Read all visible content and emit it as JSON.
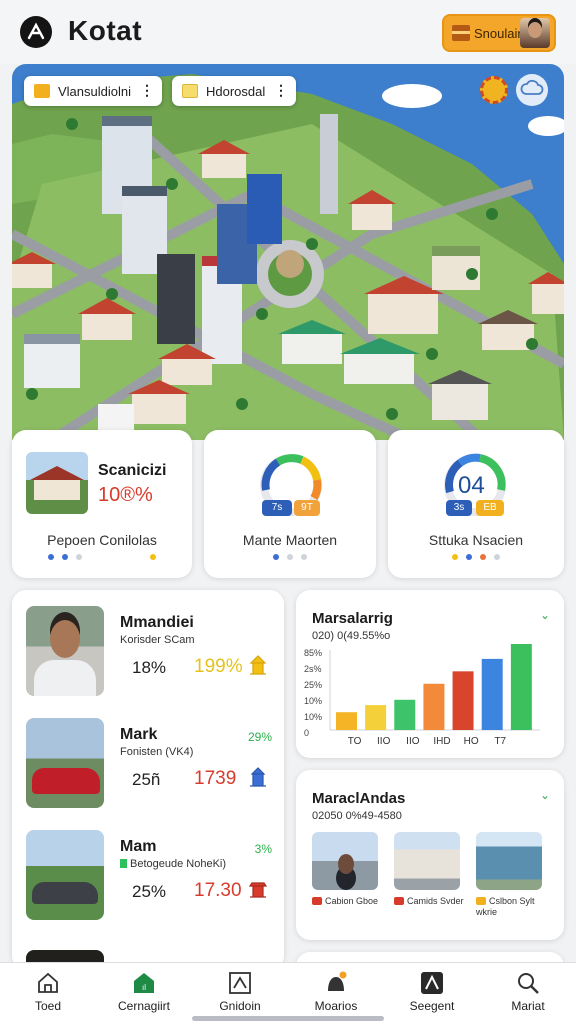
{
  "header": {
    "title": "Kotat",
    "logo_icon": "pen-logo-icon",
    "promo_label": "Snoulair",
    "promo_icon": "gift-box-icon"
  },
  "map": {
    "chips": [
      {
        "label": "Vlansuldiolni",
        "icon": "mail-icon"
      },
      {
        "label": "Hdorosdal",
        "icon": "note-icon"
      }
    ],
    "badge_icon": "award-badge-icon",
    "settings_icon": "cloud-settings-icon"
  },
  "stats": [
    {
      "title": "Scanicizi",
      "value": "10®%",
      "caption": "Pepoen Conilolas",
      "dots": [
        "#3b6fd4",
        "#3b6fd4",
        "#cfd3da",
        "#f2c010"
      ]
    },
    {
      "caption": "Mante Maorten",
      "gauge_value": 0.72,
      "pills": [
        "7s",
        "9T"
      ],
      "dots": [
        "#3b6fd4",
        "#cfd3da",
        "#cfd3da"
      ]
    },
    {
      "number": "04",
      "caption": "Sttuka Nsacien",
      "gauge_value": 0.8,
      "pills": [
        "3s",
        "EB"
      ],
      "dots": [
        "#f2c010",
        "#3b6fd4",
        "#e8743b",
        "#cfd3da"
      ]
    }
  ],
  "people": [
    {
      "name": "Mmandiei",
      "sub": "Korisder SCam",
      "left": "18%",
      "right": "199%",
      "right_color": "#e5c21c",
      "corner": "",
      "icon": "temple-icon"
    },
    {
      "name": "Mark",
      "sub": "Fonisten (VK4)",
      "left": "25ñ",
      "right": "1739",
      "right_color": "#d83b2c",
      "corner": "29%",
      "icon": "building-icon"
    },
    {
      "name": "Mam",
      "sub": "Betogeude NoheKi)",
      "left": "25%",
      "right": "17.30",
      "right_color": "#d83b2c",
      "corner": "3%",
      "icon": "shrine-icon"
    }
  ],
  "chart_card": {
    "title": "Marsalarrig",
    "subtitle": "020) 0(49.55%o"
  },
  "chart_data": {
    "type": "bar",
    "categories": [
      "TO",
      "IIO",
      "IIO",
      "IHD",
      "HO",
      "T7"
    ],
    "x_tick_labels": [
      "TO",
      "IIO",
      "IIO",
      "IHD",
      "HO",
      "T7"
    ],
    "y_tick_labels": [
      "85%",
      "2s%",
      "25%",
      "10%",
      "10%",
      "0"
    ],
    "values": [
      10,
      14,
      17,
      26,
      33,
      40
    ],
    "colors": [
      "#f4b426",
      "#f4d03a",
      "#3dc46a",
      "#f28a3a",
      "#d8452c",
      "#3b84e0",
      "#3cc05e"
    ],
    "ylim": [
      0,
      45
    ],
    "title": "Marsalarrig",
    "xlabel": "",
    "ylabel": ""
  },
  "gallery": {
    "title": "MaraclAndas",
    "subtitle": "02050 0%49-4580",
    "captions": [
      {
        "text": "Cabion Gboe",
        "color": "#d83b2c"
      },
      {
        "text": "Camids Svder",
        "color": "#d83b2c"
      },
      {
        "text": "Cslbon Sylt wkrie",
        "color": "#f2b01e"
      }
    ]
  },
  "nav": [
    {
      "label": "Toed",
      "icon": "home-icon"
    },
    {
      "label": "Cernagiirt",
      "icon": "store-icon"
    },
    {
      "label": "Gnidoin",
      "icon": "frame-icon"
    },
    {
      "label": "Moarios",
      "icon": "character-icon"
    },
    {
      "label": "Seegent",
      "icon": "arrow-icon"
    },
    {
      "label": "Mariat",
      "icon": "search-icon"
    }
  ]
}
